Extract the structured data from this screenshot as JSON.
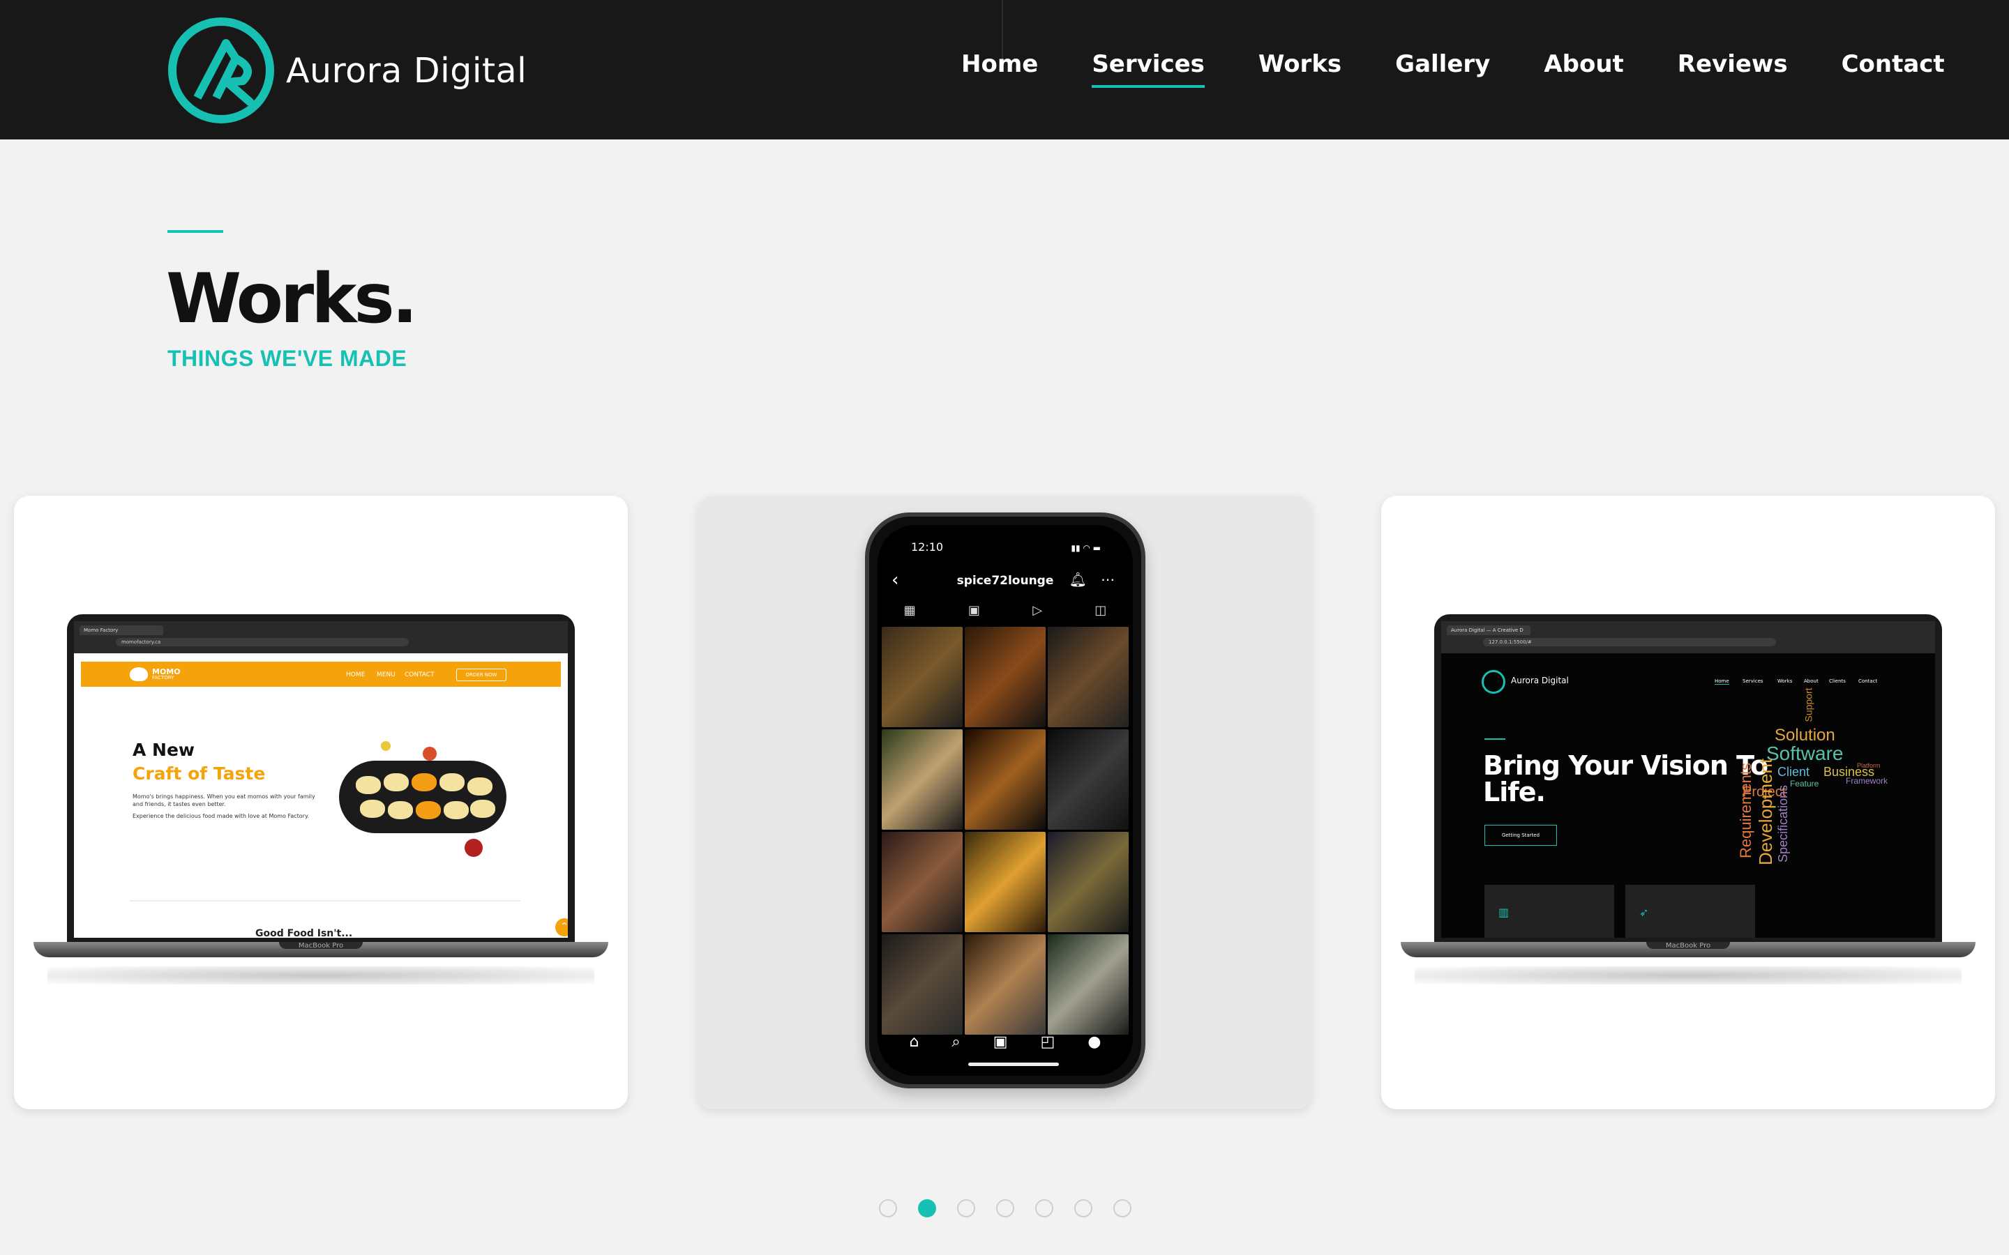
{
  "brand": {
    "name": "Aurora Digital"
  },
  "nav": {
    "items": [
      {
        "label": "Home",
        "active": false
      },
      {
        "label": "Services",
        "active": true
      },
      {
        "label": "Works",
        "active": false
      },
      {
        "label": "Gallery",
        "active": false
      },
      {
        "label": "About",
        "active": false
      },
      {
        "label": "Reviews",
        "active": false
      },
      {
        "label": "Contact",
        "active": false
      }
    ]
  },
  "section": {
    "title": "Works.",
    "subtitle": "THINGS WE'VE MADE"
  },
  "cards": [
    {
      "label": "Momo Factory laptop mockup",
      "browser": {
        "tab": "Momo Factory",
        "url": "momofactory.ca"
      },
      "site": {
        "brand_line1": "MOMO",
        "brand_line2": "FACTORY",
        "nav": [
          "HOME",
          "MENU",
          "CONTACT"
        ],
        "order_button": "ORDER NOW",
        "headline_1": "A New",
        "headline_2": "Craft of Taste",
        "paragraph_1": "Momo's brings happiness. When you eat momos with your family and friends, it tastes even better.",
        "paragraph_2": "Experience the delicious food made with love at Momo Factory.",
        "footer_text": "Good Food Isn't..."
      },
      "device_label": "MacBook Pro"
    },
    {
      "label": "spice72lounge phone mockup",
      "phone": {
        "time": "12:10",
        "username": "spice72lounge"
      }
    },
    {
      "label": "Aurora Digital laptop mockup",
      "browser": {
        "tab": "Aurora Digital — A Creative D",
        "url": "127.0.0.1:5500/#"
      },
      "site": {
        "brand": "Aurora Digital",
        "nav": [
          "Home",
          "Services",
          "Works",
          "About",
          "Clients",
          "Contact"
        ],
        "headline": "Bring Your Vision To Life.",
        "button": "Getting Started",
        "word_cloud": [
          "Support",
          "Solution",
          "Software",
          "Client",
          "Business",
          "Platform",
          "Framework",
          "Feature",
          "Project",
          "Requirements",
          "Development",
          "Specifications"
        ]
      },
      "device_label": "MacBook Pro"
    }
  ],
  "pagination": {
    "count": 7,
    "active_index": 1
  },
  "colors": {
    "accent": "#16c1b3",
    "header_bg": "#181818",
    "page_bg": "#f2f2f2",
    "momo_orange": "#f6a30b"
  }
}
